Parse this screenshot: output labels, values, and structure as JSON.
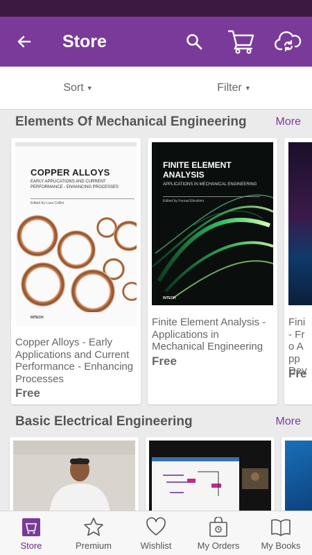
{
  "header": {
    "title": "Store"
  },
  "toolbar": {
    "sort_label": "Sort",
    "filter_label": "Filter"
  },
  "sections": [
    {
      "title": "Elements Of Mechanical Engineering",
      "more_label": "More",
      "books": [
        {
          "cover_title": "COPPER ALLOYS",
          "cover_subtitle": "EARLY APPLICATIONS AND CURRENT PERFORMANCE - ENHANCING PROCESSES",
          "cover_editor": "Edited by Luca Collini",
          "publisher": "INTECH",
          "title": "Copper Alloys - Early Applications and Current Performance - Enhancing Processes",
          "price": "Free"
        },
        {
          "cover_title": "FINITE ELEMENT ANALYSIS",
          "cover_subtitle": "APPLICATIONS IN MECHANICAL ENGINEERING",
          "cover_editor": "Edited by Farzad Ebrahimi",
          "publisher": "INTECH",
          "title": "Finite Element Analysis - Applications in Mechanical Engineering",
          "price": "Free"
        },
        {
          "title": "Fini - Fro App Dev",
          "price": "Fre"
        }
      ]
    },
    {
      "title": "Basic Electrical Engineering",
      "more_label": "More"
    }
  ],
  "bottom_nav": {
    "items": [
      {
        "label": "Store",
        "icon": "store-icon",
        "active": true
      },
      {
        "label": "Premium",
        "icon": "star-icon"
      },
      {
        "label": "Wishlist",
        "icon": "heart-icon"
      },
      {
        "label": "My Orders",
        "icon": "orders-icon"
      },
      {
        "label": "My Books",
        "icon": "book-icon"
      }
    ]
  },
  "colors": {
    "primary": "#7a3a9a",
    "status_bar": "#3a1a3f",
    "background": "#ebebeb"
  }
}
